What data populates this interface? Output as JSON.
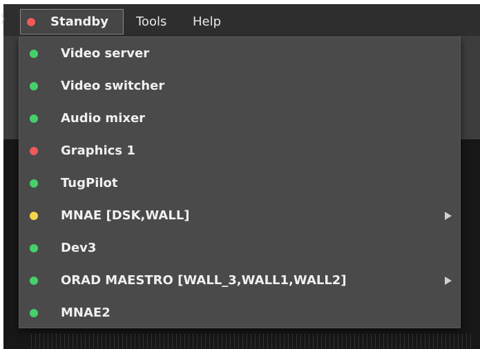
{
  "menubar": {
    "edge_glyph": ")",
    "standby": {
      "label": "Standby",
      "status_color": "#f05a5a"
    },
    "tools_label": "Tools",
    "help_label": "Help"
  },
  "colors": {
    "green": "#45d06b",
    "red": "#f05a5a",
    "yellow": "#f5d54a"
  },
  "dropdown": {
    "items": [
      {
        "label": "Video server",
        "status": "green",
        "has_submenu": false
      },
      {
        "label": "Video switcher",
        "status": "green",
        "has_submenu": false
      },
      {
        "label": "Audio mixer",
        "status": "green",
        "has_submenu": false
      },
      {
        "label": "Graphics 1",
        "status": "red",
        "has_submenu": false
      },
      {
        "label": "TugPilot",
        "status": "green",
        "has_submenu": false
      },
      {
        "label": "MNAE [DSK,WALL]",
        "status": "yellow",
        "has_submenu": true
      },
      {
        "label": "Dev3",
        "status": "green",
        "has_submenu": false
      },
      {
        "label": "ORAD MAESTRO [WALL_3,WALL1,WALL2]",
        "status": "green",
        "has_submenu": true
      },
      {
        "label": "MNAE2",
        "status": "green",
        "has_submenu": false
      }
    ]
  }
}
